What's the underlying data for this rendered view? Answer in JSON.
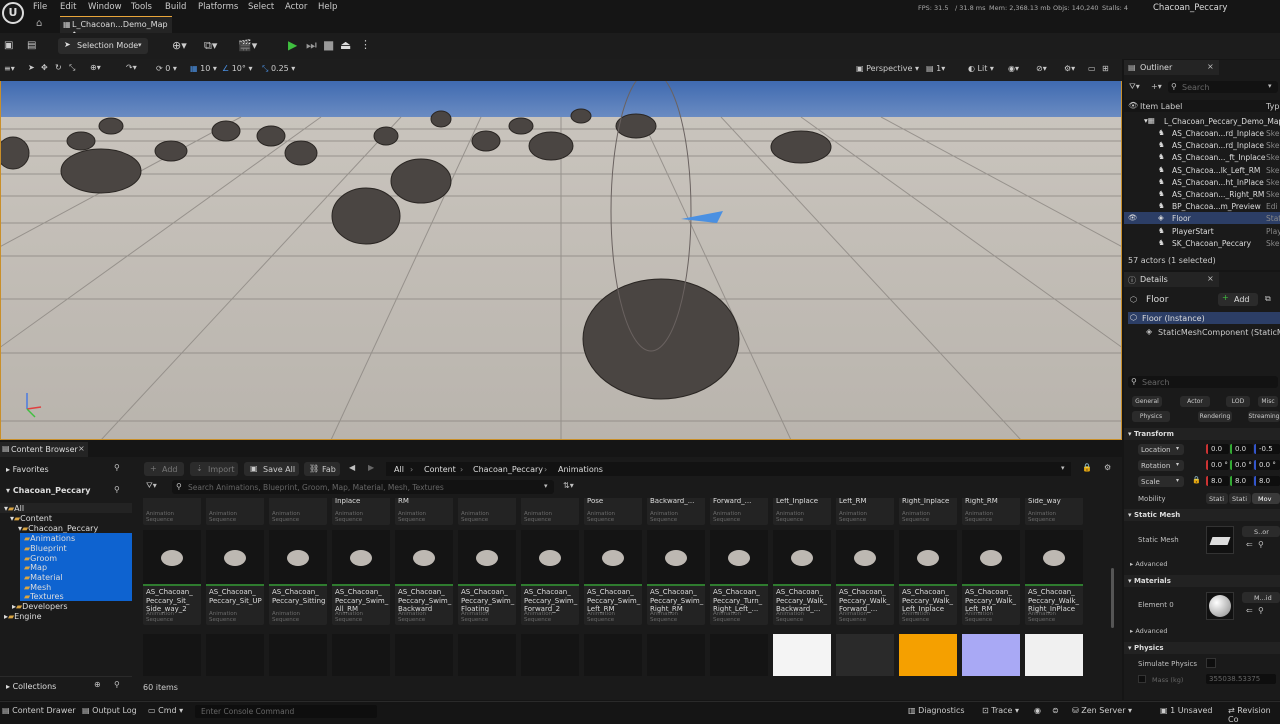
{
  "menu": [
    "File",
    "Edit",
    "Window",
    "Tools",
    "Build",
    "Platforms",
    "Select",
    "Actor",
    "Help"
  ],
  "stats": {
    "fps": "FPS: 31.5",
    "ms": "/ 31.8 ms",
    "mem": "Mem: 2,368.13 mb",
    "objs": "Objs: 140,240",
    "stalls": "Stalls: 4"
  },
  "project_name": "Chacoan_Peccary",
  "doc_tab": "L_Chacoan...Demo_Map •",
  "toolbar": {
    "mode": "Selection Mode"
  },
  "viewport_toolbar": {
    "move_snap": "0",
    "grid": "10",
    "rot": "10°",
    "scale": "0.25",
    "view": "Perspective",
    "layout": "1",
    "lit": "Lit"
  },
  "content_browser": {
    "tab": "Content Browser",
    "add": "Add",
    "import": "Import",
    "save_all": "Save All",
    "fab": "Fab",
    "breadcrumb": [
      "All",
      "Content",
      "Chacoan_Peccary",
      "Animations"
    ],
    "search_placeholder": "Search Animations, Blueprint, Groom, Map, Material, Mesh, Textures",
    "favorites": "Favorites",
    "project": "Chacoan_Peccary",
    "tree": {
      "all": "All",
      "content": "Content",
      "peccary": "Chacoan_Peccary",
      "folders": [
        "Animations",
        "Blueprint",
        "Groom",
        "Map",
        "Material",
        "Mesh",
        "Textures"
      ],
      "developers": "Developers",
      "engine": "Engine"
    },
    "collections": "Collections",
    "item_count": "60 items",
    "row1": [
      {
        "name": "",
        "type": "Animation Sequence"
      },
      {
        "name": "",
        "type": "Animation Sequence"
      },
      {
        "name": "",
        "type": "Animation Sequence"
      },
      {
        "name": "Peccary_Jump_\nInplace",
        "type": "Animation Sequence"
      },
      {
        "name": "Peccary_Jump_\nRM",
        "type": "Animation Sequence"
      },
      {
        "name": "",
        "type": "Animation Sequence"
      },
      {
        "name": "",
        "type": "Animation Sequence"
      },
      {
        "name": "Peccary_Rest_\nPose",
        "type": "Animation Sequence"
      },
      {
        "name": "Peccary_Run_\nBackward_...",
        "type": "Animation Sequence"
      },
      {
        "name": "Peccary_Run_\nForward_...",
        "type": "Animation Sequence"
      },
      {
        "name": "Peccary_Run_\nLeft_Inplace",
        "type": "Animation Sequence"
      },
      {
        "name": "Peccary_Run_\nLeft_RM",
        "type": "Animation Sequence"
      },
      {
        "name": "Peccary_Run_\nRight_Inplace",
        "type": "Animation Sequence"
      },
      {
        "name": "Peccary_Run_\nRight_RM",
        "type": "Animation Sequence"
      },
      {
        "name": "Peccary_Sit_\nSide_way",
        "type": "Animation Sequence"
      }
    ],
    "row2": [
      {
        "name": "AS_Chacoan_\nPeccary_Sit_\nSide_way_2",
        "type": "Animation Sequence"
      },
      {
        "name": "AS_Chacoan_\nPeccary_Sit_UP",
        "type": "Animation Sequence"
      },
      {
        "name": "AS_Chacoan_\nPeccary_Sitting",
        "type": "Animation Sequence"
      },
      {
        "name": "AS_Chacoan_\nPeccary_Swim_\nAll_RM",
        "type": "Animation Sequence"
      },
      {
        "name": "AS_Chacoan_\nPeccary_Swim_\nBackward",
        "type": "Animation Sequence"
      },
      {
        "name": "AS_Chacoan_\nPeccary_Swim_\nFloating",
        "type": "Animation Sequence"
      },
      {
        "name": "AS_Chacoan_\nPeccary_Swim_\nForward_2",
        "type": "Animation Sequence"
      },
      {
        "name": "AS_Chacoan_\nPeccary_Swim_\nLeft_RM",
        "type": "Animation Sequence"
      },
      {
        "name": "AS_Chacoan_\nPeccary_Swim_\nRight_RM",
        "type": "Animation Sequence"
      },
      {
        "name": "AS_Chacoan_\nPeccary_Turn_\nRight_Left_...",
        "type": "Animation Sequence"
      },
      {
        "name": "AS_Chacoan_\nPeccary_Walk_\nBackward_...",
        "type": "Animation Sequence"
      },
      {
        "name": "AS_Chacoan_\nPeccary_Walk_\nForward_...",
        "type": "Animation Sequence"
      },
      {
        "name": "AS_Chacoan_\nPeccary_Walk_\nLeft_Inplace",
        "type": "Animation Sequence"
      },
      {
        "name": "AS_Chacoan_\nPeccary_Walk_\nLeft_RM",
        "type": "Animation Sequence"
      },
      {
        "name": "AS_Chacoan_\nPeccary_Walk_\nRight_InPlace",
        "type": "Animation Sequence"
      }
    ]
  },
  "outliner": {
    "tab": "Outliner",
    "search_placeholder": "Search",
    "col_label": "Item Label",
    "col_type": "Type",
    "root": "L_Chacoan_Peccary_Demo_Map",
    "rows": [
      {
        "label": "AS_Chacoan...rd_Inplace",
        "type": "Ske"
      },
      {
        "label": "AS_Chacoan...rd_Inplace",
        "type": "Ske"
      },
      {
        "label": "AS_Chacoan..._ft_Inplace",
        "type": "Ske"
      },
      {
        "label": "AS_Chacoa...lk_Left_RM",
        "type": "Ske"
      },
      {
        "label": "AS_Chacoan...ht_InPlace",
        "type": "Ske"
      },
      {
        "label": "AS_Chacoan..._Right_RM",
        "type": "Ske"
      },
      {
        "label": "BP_Chacoa...m_Preview",
        "type": "Edi"
      },
      {
        "label": "Floor",
        "type": "Stat"
      },
      {
        "label": "PlayerStart",
        "type": "Play"
      },
      {
        "label": "SK_Chacoan_Peccary",
        "type": "Ske"
      }
    ],
    "summary": "57 actors (1 selected)"
  },
  "details": {
    "tab": "Details",
    "object": "Floor",
    "add": "Add",
    "instance": "Floor (Instance)",
    "component": "StaticMeshComponent (StaticMe",
    "search_placeholder": "Search",
    "filters": [
      "General",
      "Actor",
      "LOD",
      "Misc",
      "Physics",
      "Rendering",
      "Streaming"
    ],
    "transform": "Transform",
    "location": {
      "label": "Location",
      "x": "0.0",
      "y": "0.0",
      "z": "-0.5"
    },
    "rotation": {
      "label": "Rotation",
      "x": "0.0 °",
      "y": "0.0 °",
      "z": "0.0 °"
    },
    "scale": {
      "label": "Scale",
      "x": "8.0",
      "y": "8.0",
      "z": "8.0"
    },
    "mobility": {
      "label": "Mobility",
      "opts": [
        "Stati",
        "Stati",
        "Mov"
      ]
    },
    "static_mesh_section": "Static Mesh",
    "static_mesh_label": "Static Mesh",
    "static_mesh_value": "S..or",
    "advanced": "Advanced",
    "materials_section": "Materials",
    "element0": "Element 0",
    "element0_value": "M...id",
    "advanced2": "Advanced",
    "physics_section": "Physics",
    "simulate_physics": "Simulate Physics",
    "mass_label": "Mass (kg)",
    "mass_value": "355038.53375"
  },
  "statusbar": {
    "content_drawer": "Content Drawer",
    "output_log": "Output Log",
    "cmd": "Cmd",
    "console_placeholder": "Enter Console Command",
    "diagnostics": "Diagnostics",
    "trace": "Trace",
    "zen": "Zen Server",
    "unsaved": "1 Unsaved",
    "revision": "Revision Co"
  }
}
